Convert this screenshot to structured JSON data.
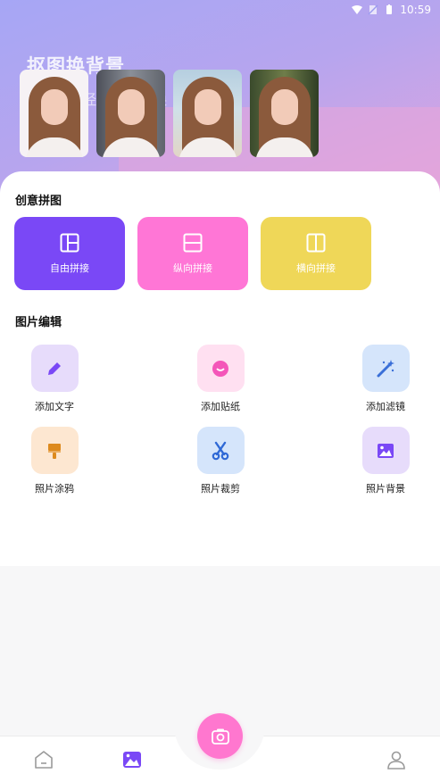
{
  "status_bar": {
    "time": "10:59"
  },
  "hero": {
    "title": "抠图换背景",
    "subtitle_fragment_left": "经",
    "subtitle_fragment_right": "换"
  },
  "collage": {
    "title": "创意拼图",
    "items": [
      {
        "label": "自由拼接",
        "color": "#7a48f6"
      },
      {
        "label": "纵向拼接",
        "color": "#ff76d6"
      },
      {
        "label": "横向拼接",
        "color": "#efd758"
      }
    ]
  },
  "editing": {
    "title": "图片编辑",
    "tools": [
      {
        "label": "添加文字",
        "icon": "pencil-icon"
      },
      {
        "label": "添加贴纸",
        "icon": "smiley-sticker-icon"
      },
      {
        "label": "添加滤镜",
        "icon": "magic-wand-icon"
      },
      {
        "label": "照片涂鸦",
        "icon": "paint-brush-icon"
      },
      {
        "label": "照片裁剪",
        "icon": "scissors-icon"
      },
      {
        "label": "照片背景",
        "icon": "image-background-icon"
      }
    ]
  },
  "bottom_nav": {
    "items": [
      "home-icon",
      "gallery-icon",
      "profile-icon"
    ],
    "center_button": "camera-icon"
  }
}
